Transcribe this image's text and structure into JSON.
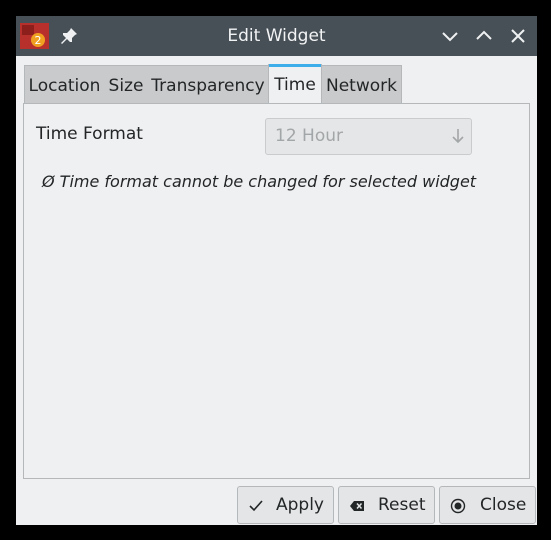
{
  "window": {
    "title": "Edit Widget",
    "titlebar_color": "#475057",
    "app_icon": "app-icon",
    "app_icon_badge": "2",
    "pin_icon": "pin-icon",
    "controls": [
      "chevron-down-icon",
      "chevron-up-icon",
      "close-icon"
    ]
  },
  "tabs": [
    {
      "label": "Location",
      "active": false
    },
    {
      "label": "Size",
      "active": false
    },
    {
      "label": "Transparency",
      "active": false
    },
    {
      "label": "Time",
      "active": true
    },
    {
      "label": "Network",
      "active": false
    }
  ],
  "time_tab": {
    "time_format_label": "Time Format",
    "time_format_value": "12 Hour",
    "time_format_enabled": false,
    "warning": "Ø Time format cannot be changed for selected widget"
  },
  "buttons": {
    "apply": "Apply",
    "reset": "Reset",
    "close": "Close"
  },
  "colors": {
    "accent": "#3daee9",
    "background": "#eff0f1",
    "text": "#232627",
    "disabled_text": "#a3a6a8"
  }
}
